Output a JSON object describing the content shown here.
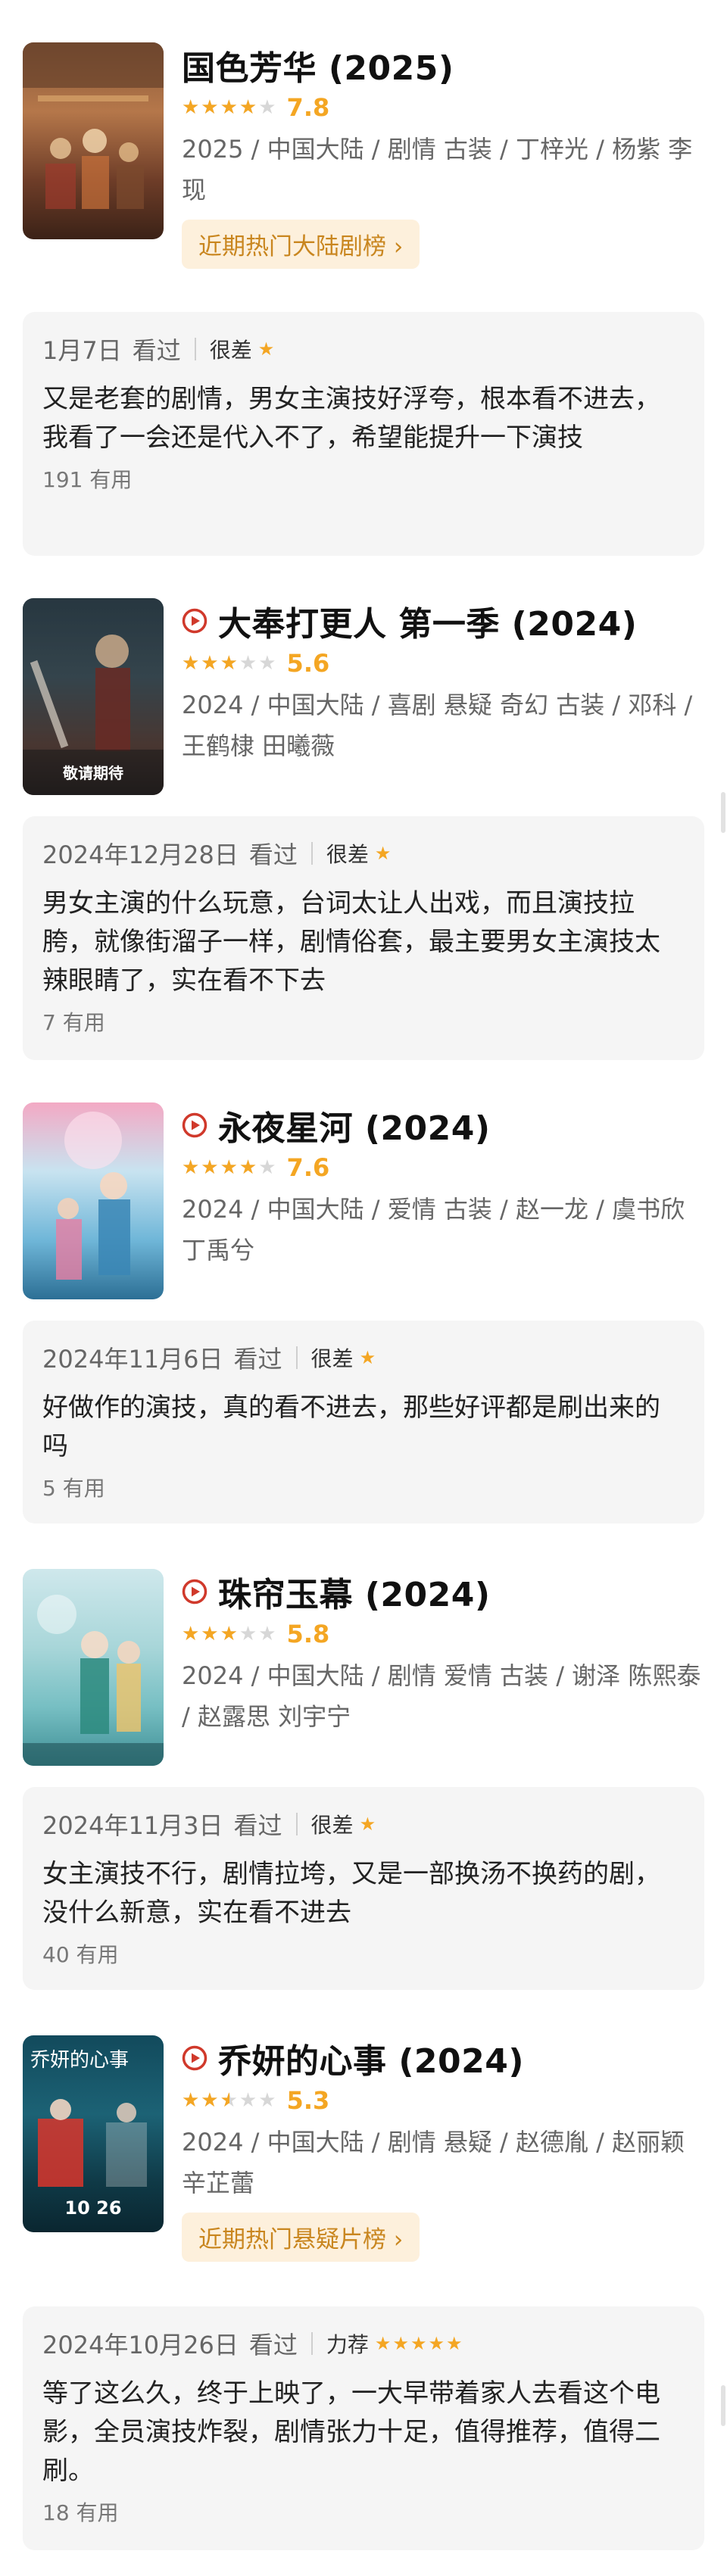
{
  "entries": [
    {
      "title": "国色芳华 (2025)",
      "has_play_icon": false,
      "stars_fraction": 0.8,
      "score": "7.8",
      "meta": "2025 / 中国大陆 / 剧情 古装 / 丁梓光 / 杨紫 李现",
      "rank_label": "近期热门大陆剧榜 ›",
      "review": {
        "date": "1月7日",
        "watched": "看过",
        "verdict": "很差",
        "verdict_stars": "★",
        "text": "又是老套的剧情，男女主演技好浮夸，根本看不进去，我看了一会还是代入不了，希望能提升一下演技",
        "useful": "191 有用"
      }
    },
    {
      "title": "大奉打更人 第一季 (2024)",
      "has_play_icon": true,
      "stars_fraction": 0.6,
      "score": "5.6",
      "meta": "2024 / 中国大陆 / 喜剧 悬疑 奇幻 古装 / 邓科 / 王鹤棣 田曦薇",
      "poster_caption": "敬请期待",
      "review": {
        "date": "2024年12月28日",
        "watched": "看过",
        "verdict": "很差",
        "verdict_stars": "★",
        "text": "男女主演的什么玩意，台词太让人出戏，而且演技拉胯，就像街溜子一样，剧情俗套，最主要男女主演技太辣眼睛了，实在看不下去",
        "useful": "7 有用"
      }
    },
    {
      "title": "永夜星河 (2024)",
      "has_play_icon": true,
      "stars_fraction": 0.8,
      "score": "7.6",
      "meta": "2024 / 中国大陆 / 爱情 古装 / 赵一龙 / 虞书欣 丁禹兮",
      "review": {
        "date": "2024年11月6日",
        "watched": "看过",
        "verdict": "很差",
        "verdict_stars": "★",
        "text": "好做作的演技，真的看不进去，那些好评都是刷出来的吗",
        "useful": "5 有用"
      }
    },
    {
      "title": "珠帘玉幕 (2024)",
      "has_play_icon": true,
      "stars_fraction": 0.6,
      "score": "5.8",
      "meta": "2024 / 中国大陆 / 剧情 爱情 古装 / 谢泽 陈熙泰 / 赵露思 刘宇宁",
      "review": {
        "date": "2024年11月3日",
        "watched": "看过",
        "verdict": "很差",
        "verdict_stars": "★",
        "text": "女主演技不行，剧情拉垮，又是一部换汤不换药的剧，没什么新意，实在看不进去",
        "useful": "40 有用"
      }
    },
    {
      "title": "乔妍的心事 (2024)",
      "has_play_icon": true,
      "stars_fraction": 0.5,
      "score": "5.3",
      "meta": "2024 / 中国大陆 / 剧情 悬疑 / 赵德胤 / 赵丽颖 辛芷蕾",
      "rank_label": "近期热门悬疑片榜 ›",
      "poster_script": "乔妍的心事",
      "poster_date": "10 26",
      "review": {
        "date": "2024年10月26日",
        "watched": "看过",
        "verdict": "力荐",
        "verdict_stars": "★★★★★",
        "text": "等了这么久，终于上映了，一大早带着家人去看这个电影，全员演技炸裂，剧情张力十足，值得推荐，值得二刷。",
        "useful": "18 有用"
      }
    }
  ]
}
